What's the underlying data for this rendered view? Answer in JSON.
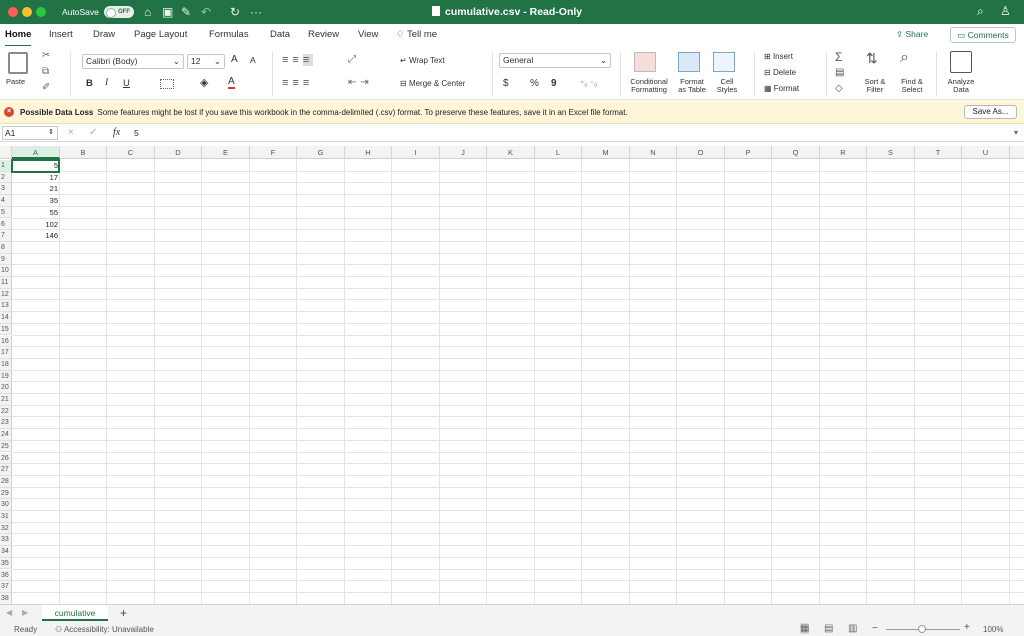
{
  "window": {
    "autosave_label": "AutoSave",
    "autosave_state": "OFF",
    "title": "cumulative.csv - Read-Only",
    "more": "···"
  },
  "tabs": [
    "Home",
    "Insert",
    "Draw",
    "Page Layout",
    "Formulas",
    "Data",
    "Review",
    "View",
    "Tell me"
  ],
  "share_label": "Share",
  "comments_label": "Comments",
  "ribbon": {
    "paste": "Paste",
    "font_name": "Calibri (Body)",
    "font_size": "12",
    "bold": "B",
    "italic": "I",
    "underline": "U",
    "grow": "A",
    "shrink": "A",
    "wrap_text": "Wrap Text",
    "merge_center": "Merge & Center",
    "number_format": "General",
    "currency": "$",
    "percent": "%",
    "comma": "9",
    "conditional_formatting": [
      "Conditional",
      "Formatting"
    ],
    "format_as_table": [
      "Format",
      "as Table"
    ],
    "cell_styles": [
      "Cell",
      "Styles"
    ],
    "insert": "Insert",
    "delete": "Delete",
    "format": "Format",
    "sort_filter": [
      "Sort &",
      "Filter"
    ],
    "find_select": [
      "Find &",
      "Select"
    ],
    "analyze_data": [
      "Analyze",
      "Data"
    ]
  },
  "banner": {
    "title": "Possible Data Loss",
    "message": "Some features might be lost if you save this workbook in the comma-delimited (.csv) format. To preserve these features, save it in an Excel file format.",
    "save_as": "Save As..."
  },
  "formula_bar": {
    "name_box": "A1",
    "fx": "fx",
    "value": "5"
  },
  "columns": [
    "A",
    "B",
    "C",
    "D",
    "E",
    "F",
    "G",
    "H",
    "I",
    "J",
    "K",
    "L",
    "M",
    "N",
    "O",
    "P",
    "Q",
    "R",
    "S",
    "T",
    "U"
  ],
  "rows": [
    "1",
    "2",
    "3",
    "4",
    "5",
    "6",
    "7",
    "8",
    "9",
    "10",
    "11",
    "12",
    "13",
    "14",
    "15",
    "16",
    "17",
    "18",
    "19",
    "20",
    "21",
    "22",
    "23",
    "24",
    "25",
    "26",
    "27",
    "28",
    "29",
    "30",
    "31",
    "32",
    "33",
    "34",
    "35",
    "36",
    "37",
    "38"
  ],
  "cells_a": [
    "5",
    "17",
    "21",
    "35",
    "55",
    "102",
    "146"
  ],
  "sheet_tab": "cumulative",
  "add_sheet": "+",
  "status": {
    "ready": "Ready",
    "accessibility": "Accessibility: Unavailable",
    "zoom": "100%",
    "zoom_minus": "−",
    "zoom_plus": "+"
  },
  "colors": {
    "accent": "#217346",
    "banner": "#fdf6d8",
    "error": "#d34a30"
  }
}
